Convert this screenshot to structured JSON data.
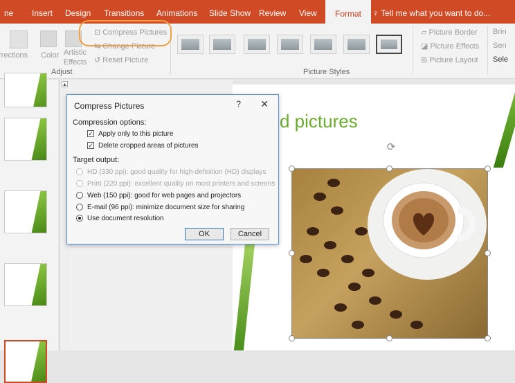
{
  "ribbon_tabs": [
    {
      "label": "ne",
      "state": "normal"
    },
    {
      "label": "Insert",
      "state": "normal"
    },
    {
      "label": "Design",
      "state": "normal"
    },
    {
      "label": "Transitions",
      "state": "normal"
    },
    {
      "label": "Animations",
      "state": "normal"
    },
    {
      "label": "Slide Show",
      "state": "normal"
    },
    {
      "label": "Review",
      "state": "normal"
    },
    {
      "label": "View",
      "state": "normal"
    },
    {
      "label": "Format",
      "state": "active"
    }
  ],
  "tell_me": "Tell me what you want to do...",
  "ribbon": {
    "adjust_group_label": "Adjust",
    "adjust_items": {
      "corrections": "rrections",
      "color": "Color",
      "artistic_effects_line1": "Artistic",
      "artistic_effects_line2": "Effects",
      "compress_pictures": "Compress Pictures",
      "change_picture": "Change Picture",
      "reset_picture": "Reset Picture"
    },
    "picture_styles_label": "Picture Styles",
    "picture_options": {
      "border": "Picture Border",
      "effects": "Picture Effects",
      "layout": "Picture Layout"
    },
    "arrange_items": {
      "bring": "Brin",
      "send": "Sen",
      "select": "Sele"
    }
  },
  "slide": {
    "title": "d pictures"
  },
  "dialog": {
    "title": "Compress Pictures",
    "help": "?",
    "close": "✕",
    "compression_options_label": "Compression options:",
    "checkboxes": [
      {
        "label": "Apply only to this picture",
        "checked": true
      },
      {
        "label": "Delete cropped areas of pictures",
        "checked": true
      }
    ],
    "target_output_label": "Target output:",
    "radios": [
      {
        "label": "HD (330 ppi): good quality for high-definition (HD) displays",
        "enabled": false,
        "selected": false
      },
      {
        "label": "Print (220 ppi): excellent quality on most printers and screens",
        "enabled": false,
        "selected": false
      },
      {
        "label": "Web (150 ppi): good for web pages and projectors",
        "enabled": true,
        "selected": false
      },
      {
        "label": "E-mail (96 ppi): minimize document size for sharing",
        "enabled": true,
        "selected": false
      },
      {
        "label": "Use document resolution",
        "enabled": true,
        "selected": true
      }
    ],
    "ok_label": "OK",
    "cancel_label": "Cancel"
  },
  "colors": {
    "ribbon_tab_bar": "#d04a26",
    "highlight_circle": "#f0a040",
    "slide_title": "#6cab2f",
    "dialog_border": "#5a8fd1"
  }
}
